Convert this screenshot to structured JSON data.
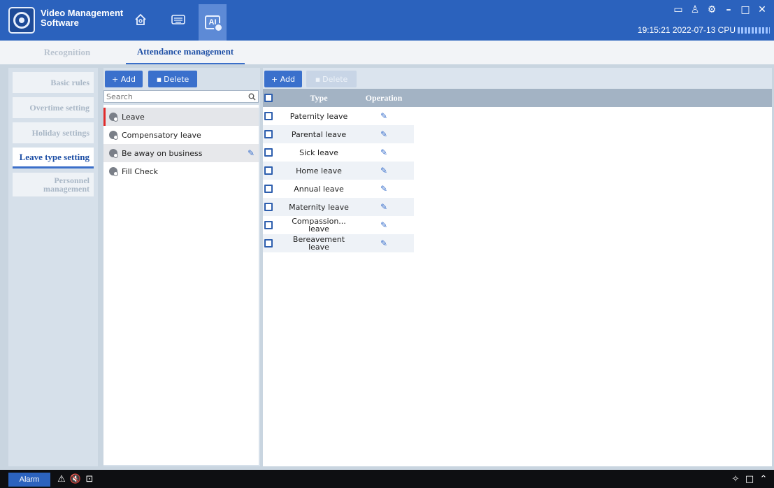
{
  "app": {
    "title_line1": "Video Management",
    "title_line2": "Software",
    "logo_icon": "camera-lens-icon",
    "nav": [
      {
        "name": "home-icon",
        "glyph": "⌂"
      },
      {
        "name": "keyboard-icon",
        "glyph": "⌨"
      },
      {
        "name": "ai-settings-icon",
        "glyph": "AI"
      }
    ],
    "window_controls": [
      {
        "name": "screen-icon",
        "glyph": "🖵"
      },
      {
        "name": "user-icon",
        "glyph": "👤"
      },
      {
        "name": "settings-icon",
        "glyph": "⚙"
      },
      {
        "name": "minimize-icon",
        "glyph": "–"
      },
      {
        "name": "maximize-icon",
        "glyph": "□"
      },
      {
        "name": "close-icon",
        "glyph": "✕"
      }
    ],
    "status": "19:15:21 2022-07-13 CPU"
  },
  "tabs": {
    "recognition": "Recognition",
    "attendance": "Attendance management"
  },
  "rail": {
    "items": [
      {
        "label": "Basic rules"
      },
      {
        "label": "Overtime setting"
      },
      {
        "label": "Holiday settings"
      },
      {
        "label": "Leave type setting"
      },
      {
        "label": "Personnel management"
      }
    ]
  },
  "middle": {
    "add_label": "+ Add",
    "delete_label": "Delete",
    "search_placeholder": "Search",
    "items": [
      {
        "label": "Leave"
      },
      {
        "label": "Compensatory leave"
      },
      {
        "label": "Be away on business"
      },
      {
        "label": "Fill Check"
      }
    ]
  },
  "right": {
    "add_label": "+ Add",
    "delete_label": "Delete",
    "col_type": "Type",
    "col_operation": "Operation",
    "rows": [
      {
        "type": "Paternity leave"
      },
      {
        "type": "Parental leave"
      },
      {
        "type": "Sick leave"
      },
      {
        "type": "Home leave"
      },
      {
        "type": "Annual leave"
      },
      {
        "type": "Maternity leave"
      },
      {
        "type": "Compassion... leave"
      },
      {
        "type": "Bereavement leave"
      }
    ]
  },
  "bottom": {
    "alarm_label": "Alarm"
  },
  "colors": {
    "titlebar": "#2b62bd",
    "accent": "#3a70cc",
    "selected_marker": "#e02a2a"
  }
}
